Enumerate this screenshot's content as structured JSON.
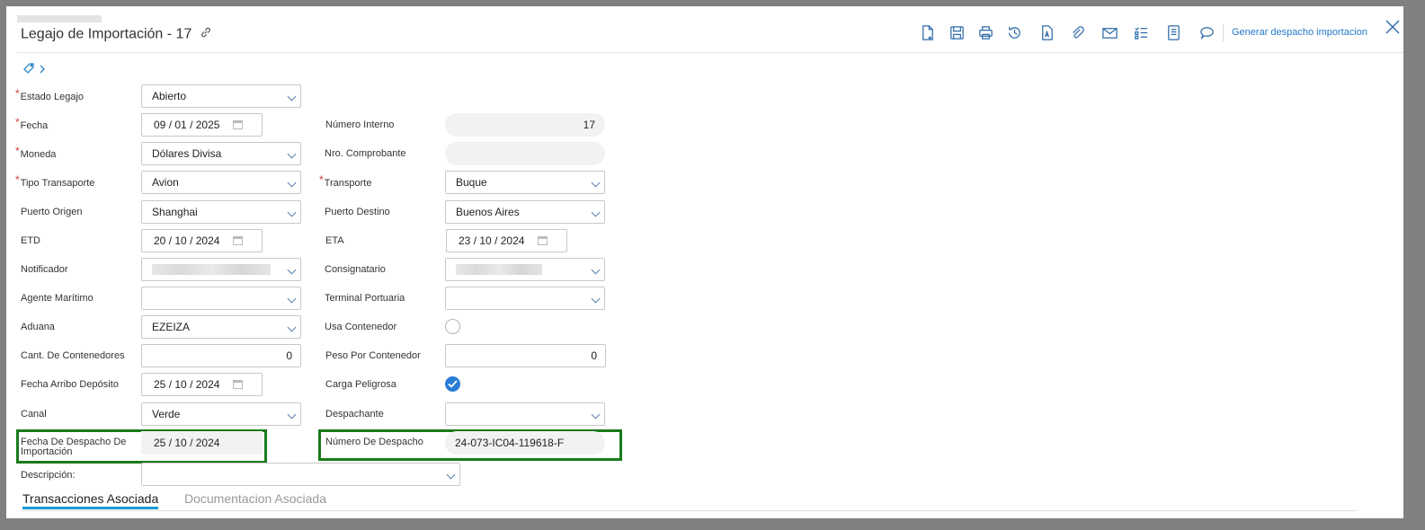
{
  "header": {
    "title": "Legajo de Importación - 17",
    "generate_button": "Generar despacho importacion"
  },
  "toolbar_icons": [
    "new-document-icon",
    "save-icon",
    "print-icon",
    "history-icon",
    "text-document-icon",
    "attachment-icon",
    "email-icon",
    "checklist-icon",
    "notes-icon",
    "comment-icon"
  ],
  "form": {
    "estado_legajo": {
      "label": "Estado Legajo",
      "value": "Abierto"
    },
    "fecha": {
      "label": "Fecha",
      "day": "09",
      "month": "01",
      "year": "2025"
    },
    "numero_interno": {
      "label": "Número Interno",
      "value": "17"
    },
    "moneda": {
      "label": "Moneda",
      "value": "Dólares Divisa"
    },
    "nro_comprobante": {
      "label": "Nro. Comprobante",
      "value": ""
    },
    "tipo_transporte": {
      "label": "Tipo Transaporte",
      "value": "Avion"
    },
    "transporte": {
      "label": "Transporte",
      "value": "Buque"
    },
    "puerto_origen": {
      "label": "Puerto Origen",
      "value": "Shanghai"
    },
    "puerto_destino": {
      "label": "Puerto Destino",
      "value": "Buenos Aires"
    },
    "etd": {
      "label": "ETD",
      "day": "20",
      "month": "10",
      "year": "2024"
    },
    "eta": {
      "label": "ETA",
      "day": "23",
      "month": "10",
      "year": "2024"
    },
    "notificador": {
      "label": "Notificador"
    },
    "consignatario": {
      "label": "Consignatario"
    },
    "agente_maritimo": {
      "label": "Agente Marítimo",
      "value": ""
    },
    "terminal_portuaria": {
      "label": "Terminal Portuaria",
      "value": ""
    },
    "aduana": {
      "label": "Aduana",
      "value": "EZEIZA"
    },
    "usa_contenedor": {
      "label": "Usa Contenedor",
      "checked": false
    },
    "cant_contenedores": {
      "label": "Cant. De Contenedores",
      "value": "0"
    },
    "peso_contenedor": {
      "label": "Peso Por Contenedor",
      "value": "0"
    },
    "fecha_arribo": {
      "label": "Fecha Arribo Depósito",
      "day": "25",
      "month": "10",
      "year": "2024"
    },
    "carga_peligrosa": {
      "label": "Carga Peligrosa",
      "checked": true
    },
    "canal": {
      "label": "Canal",
      "value": "Verde"
    },
    "despachante": {
      "label": "Despachante",
      "value": ""
    },
    "fecha_despacho": {
      "label": "Fecha De Despacho De Importación",
      "day": "25",
      "month": "10",
      "year": "2024"
    },
    "numero_despacho": {
      "label": "Número De Despacho",
      "value": "24-073-IC04-119618-F"
    },
    "descripcion": {
      "label": "Descripción:",
      "value": ""
    }
  },
  "tabs": [
    {
      "label": "Transacciones Asociada",
      "active": true
    },
    {
      "label": "Documentacion Asociada",
      "active": false
    }
  ],
  "colors": {
    "accent": "#2c6aa8",
    "highlight": "#1a7a1a",
    "tab_underline": "#1a9bd7",
    "required": "#d8363c"
  }
}
